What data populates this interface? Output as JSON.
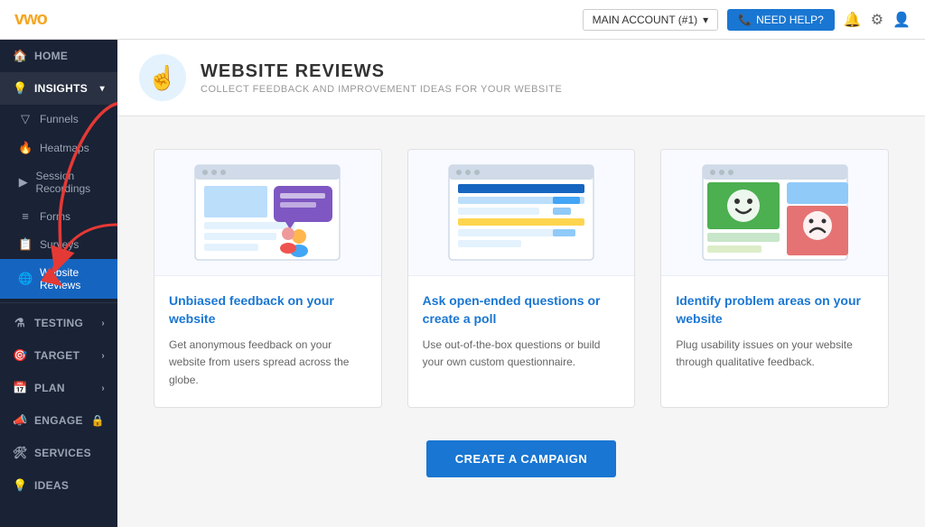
{
  "topbar": {
    "logo": "vwo",
    "account_label": "MAIN ACCOUNT (#1)",
    "need_help_label": "NEED HELP?",
    "phone_icon": "📞",
    "bell_icon": "🔔",
    "gear_icon": "⚙",
    "user_icon": "👤"
  },
  "sidebar": {
    "home_label": "HOME",
    "insights_label": "INSIGHTS",
    "funnels_label": "Funnels",
    "heatmaps_label": "Heatmaps",
    "session_recordings_label": "Session Recordings",
    "forms_label": "Forms",
    "surveys_label": "Surveys",
    "website_reviews_label": "Website Reviews",
    "testing_label": "TESTING",
    "target_label": "TARGET",
    "plan_label": "PLAN",
    "engage_label": "ENGAGE",
    "services_label": "SERVICES",
    "ideas_label": "IDEAS"
  },
  "page_header": {
    "title": "WEBSITE REVIEWS",
    "subtitle": "COLLECT FEEDBACK AND IMPROVEMENT IDEAS FOR YOUR WEBSITE",
    "icon": "☝"
  },
  "cards": [
    {
      "id": "card1",
      "title": "Unbiased feedback on your website",
      "description": "Get anonymous feedback on your website from users spread across the globe."
    },
    {
      "id": "card2",
      "title": "Ask open-ended questions or create a poll",
      "description": "Use out-of-the-box questions or build your own custom questionnaire."
    },
    {
      "id": "card3",
      "title": "Identify problem areas on your website",
      "description": "Plug usability issues on your website through qualitative feedback."
    }
  ],
  "cta": {
    "label": "CREATE A CAMPAIGN"
  }
}
